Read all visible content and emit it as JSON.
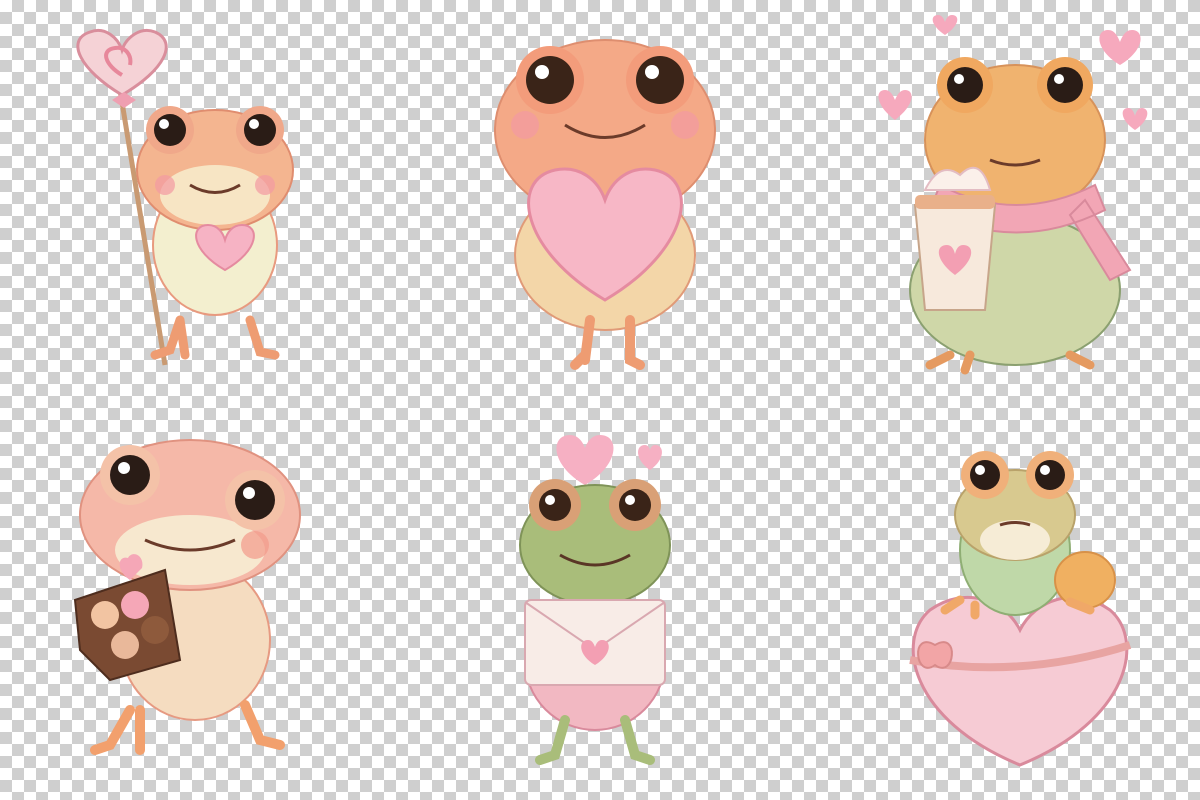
{
  "image": {
    "background": "transparency-checkerboard",
    "palette": {
      "skin_pink": "#f2a3a8",
      "skin_orange": "#f0a070",
      "belly_cream": "#f3efcf",
      "green": "#b9c98a",
      "heart_pink": "#f6b3c4",
      "chocolate": "#7a4a32",
      "eye_dark": "#2a1c16"
    },
    "frogs": [
      {
        "name": "frog-with-lollipop",
        "props": [
          "lollipop-icon",
          "heart-icon"
        ]
      },
      {
        "name": "frog-hugging-heart-pillow",
        "props": [
          "heart-pillow-icon"
        ]
      },
      {
        "name": "frog-with-hot-cocoa-and-scarf",
        "props": [
          "cocoa-cup-icon",
          "scarf-icon",
          "heart-icon"
        ]
      },
      {
        "name": "frog-with-chocolate-box",
        "props": [
          "chocolate-box-icon"
        ]
      },
      {
        "name": "frog-with-love-letter",
        "props": [
          "envelope-icon",
          "heart-icon"
        ]
      },
      {
        "name": "frog-on-heart-gift-box",
        "props": [
          "heart-gift-box-icon"
        ]
      }
    ]
  }
}
